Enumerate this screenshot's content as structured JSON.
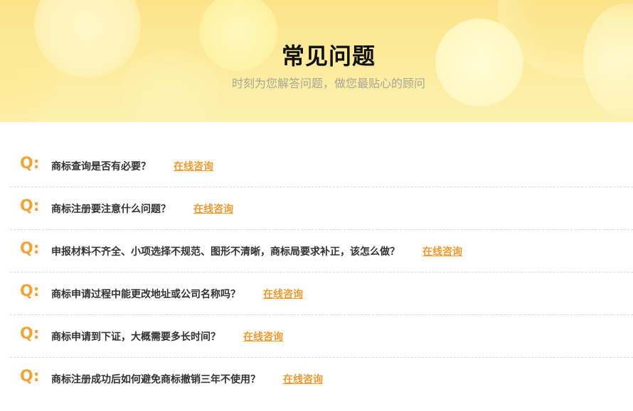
{
  "banner": {
    "title": "常见问题",
    "subtitle": "时刻为您解答问题，做您最贴心的顾问"
  },
  "faq": {
    "q_label": "Q:",
    "link_label": "在线咨询",
    "items": [
      {
        "question": "商标查询是否有必要？"
      },
      {
        "question": "商标注册要注意什么问题？"
      },
      {
        "question": "申报材料不齐全、小项选择不规范、图形不清晰，商标局要求补正，该怎么做？"
      },
      {
        "question": "商标申请过程中能更改地址或公司名称吗？"
      },
      {
        "question": "商标申请到下证，大概需要多长时间？"
      },
      {
        "question": "商标注册成功后如何避免商标撤销三年不使用？"
      }
    ]
  },
  "colors": {
    "accent": "#ef9a2f",
    "banner_bg": "#fbe38a",
    "text": "#333333",
    "subtitle": "#a8a595"
  }
}
